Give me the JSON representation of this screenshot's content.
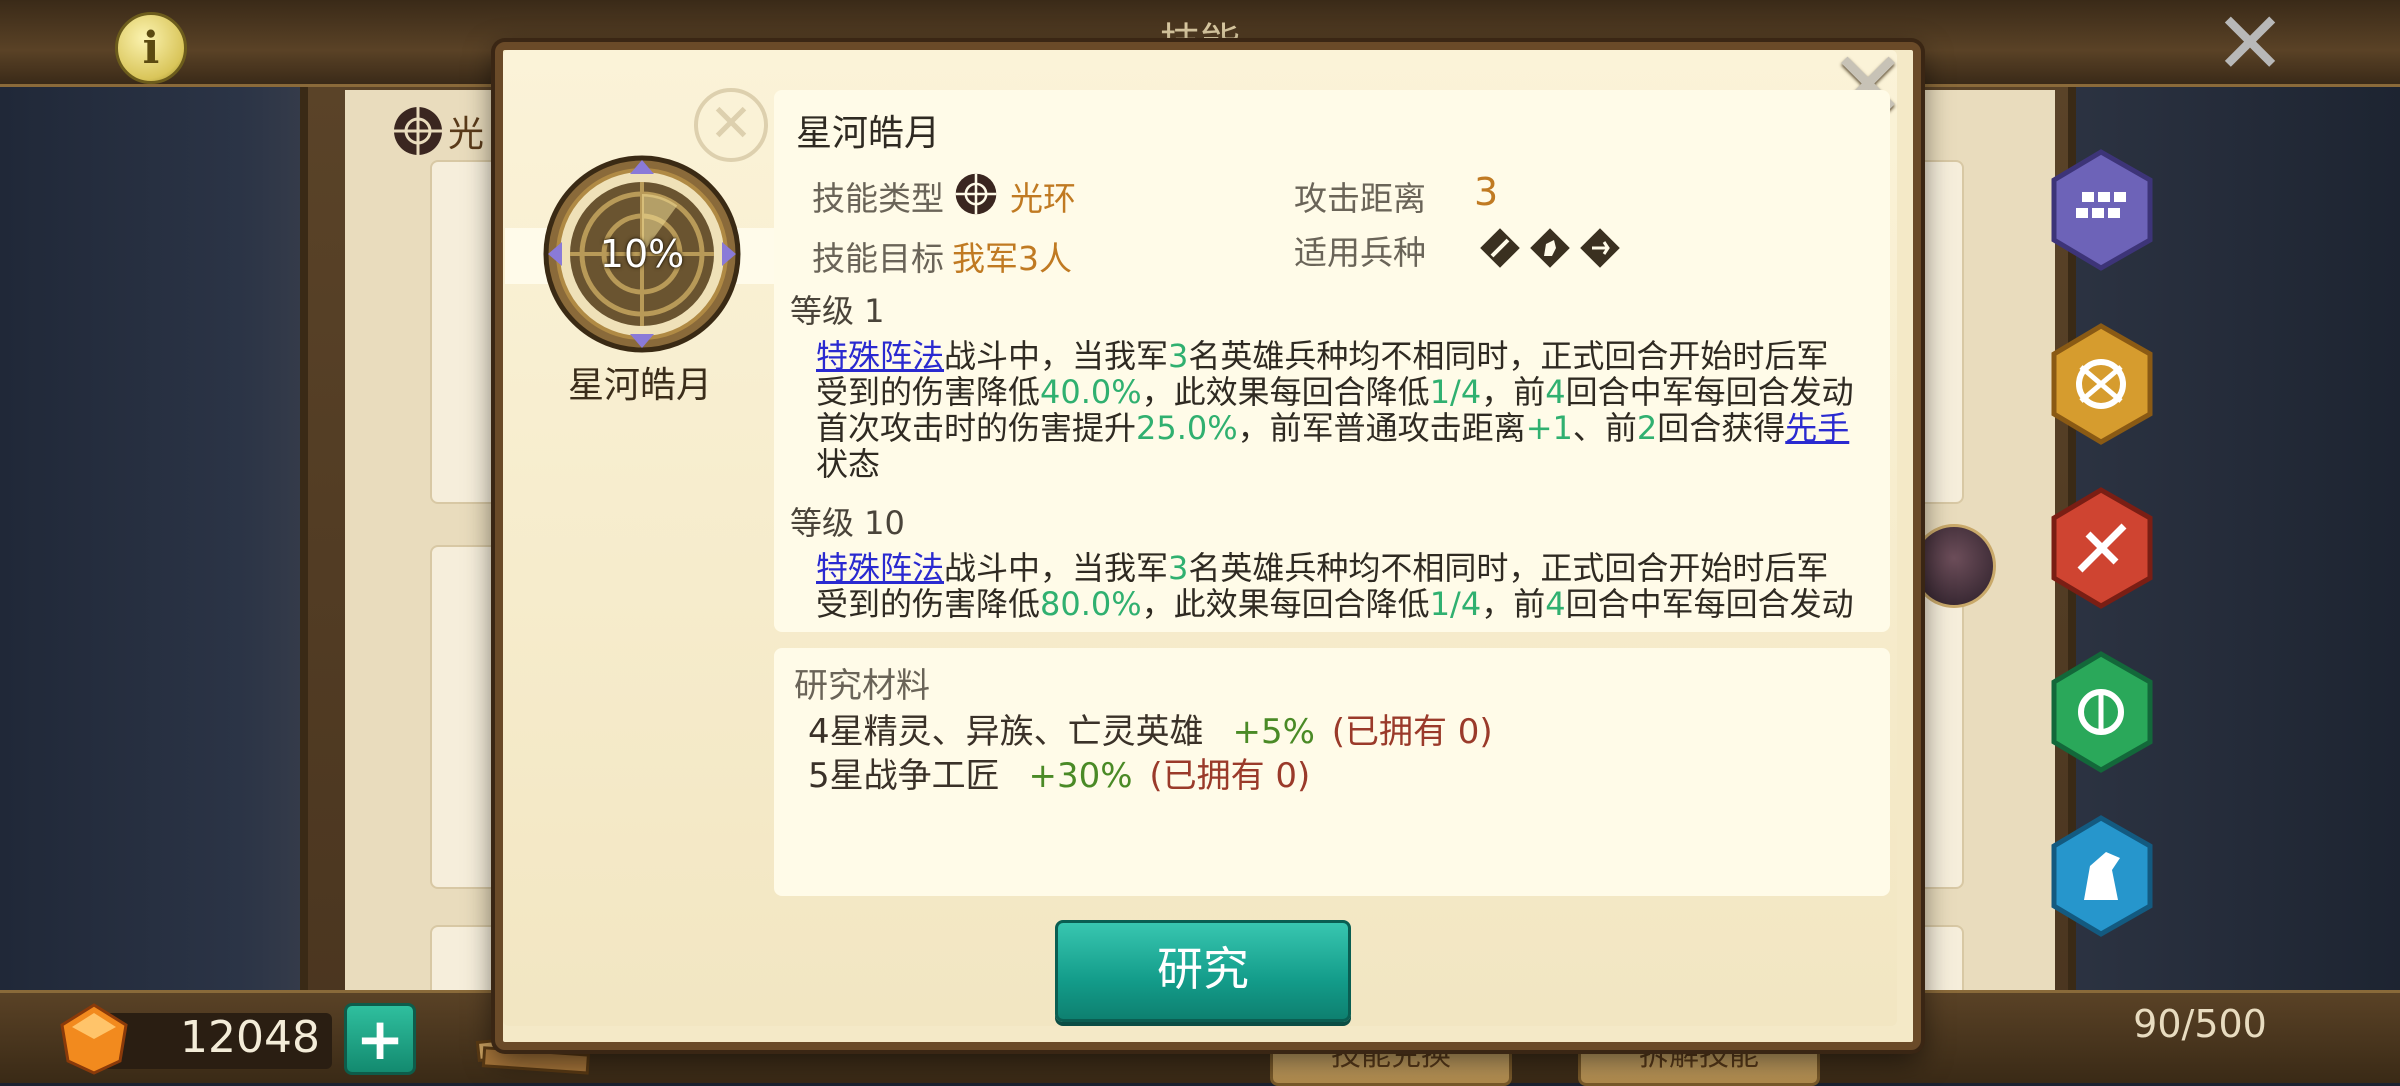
{
  "screen": {
    "title": "技能"
  },
  "background": {
    "tab_label": "光"
  },
  "currency": {
    "amount": "12048",
    "add_label": "+"
  },
  "bottom_buttons": [
    {
      "label": "技能兑换"
    },
    {
      "label": "拆解技能"
    }
  ],
  "storage": {
    "capacity": "90/500"
  },
  "categories": [
    {
      "icon": "formation-icon",
      "color": "#7b73c9"
    },
    {
      "icon": "aura-icon",
      "color": "#d9a132"
    },
    {
      "icon": "attack-icon",
      "color": "#d24a34"
    },
    {
      "icon": "support-icon",
      "color": "#2eae5e"
    },
    {
      "icon": "cavalry-icon",
      "color": "#2a9ad0"
    }
  ],
  "skill": {
    "name": "星河皓月",
    "progress_text": "10%",
    "progress": 0.1,
    "type_label": "技能类型",
    "type_value": "光环",
    "target_label": "技能目标",
    "target_value": "我军3人",
    "range_label": "攻击距离",
    "range_value": "3",
    "troops_label": "适用兵种",
    "troop_icons": [
      "infantry-icon",
      "cavalry-icon",
      "archer-icon"
    ],
    "levels": [
      {
        "label": "等级 1",
        "segments": [
          {
            "t": "特殊阵法",
            "s": "lk"
          },
          {
            "t": "战斗中，当我军"
          },
          {
            "t": "3",
            "s": "g"
          },
          {
            "t": "名英雄兵种均不相同时，正式回合开始时后军受到的伤害降低"
          },
          {
            "t": "40.0%",
            "s": "g"
          },
          {
            "t": "，此效果每回合降低"
          },
          {
            "t": "1/4",
            "s": "g"
          },
          {
            "t": "，前"
          },
          {
            "t": "4",
            "s": "g"
          },
          {
            "t": "回合中军每回合发动首次攻击时的伤害提升"
          },
          {
            "t": "25.0%",
            "s": "g"
          },
          {
            "t": "，前军普通攻击距离"
          },
          {
            "t": "+1",
            "s": "g"
          },
          {
            "t": "、前"
          },
          {
            "t": "2",
            "s": "g"
          },
          {
            "t": "回合获得"
          },
          {
            "t": "先手",
            "s": "lk"
          },
          {
            "t": "状态"
          }
        ]
      },
      {
        "label": "等级 10",
        "segments": [
          {
            "t": "特殊阵法",
            "s": "lk"
          },
          {
            "t": "战斗中，当我军"
          },
          {
            "t": "3",
            "s": "g"
          },
          {
            "t": "名英雄兵种均不相同时，正式回合开始时后军受到的伤害降低"
          },
          {
            "t": "80.0%",
            "s": "g"
          },
          {
            "t": "，此效果每回合降低"
          },
          {
            "t": "1/4",
            "s": "g"
          },
          {
            "t": "，前"
          },
          {
            "t": "4",
            "s": "g"
          },
          {
            "t": "回合中军每回合发动"
          }
        ]
      }
    ]
  },
  "materials": {
    "title": "研究材料",
    "items": [
      {
        "name": "4星精灵、异族、亡灵英雄",
        "bonus": "+5%",
        "owned": "(已拥有 0)"
      },
      {
        "name": "5星战争工匠",
        "bonus": "+30%",
        "owned": "(已拥有 0)"
      }
    ]
  },
  "actions": {
    "research_label": "研究"
  }
}
